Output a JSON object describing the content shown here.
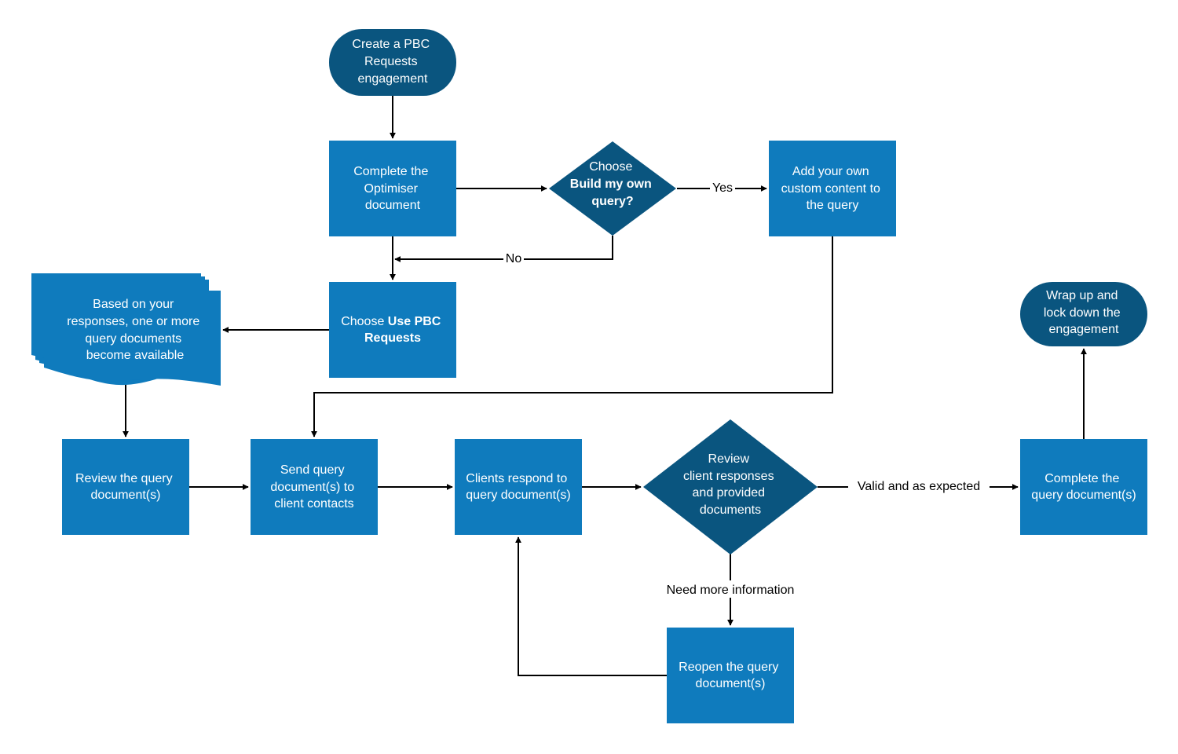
{
  "colors": {
    "process": "#0F7BBD",
    "terminator": "#0A557F",
    "decision": "#0A557F",
    "document": "#0F7BBD",
    "edge": "#000000",
    "text": "#ffffff"
  },
  "nodes": {
    "start": {
      "type": "terminator",
      "lines": [
        "Create a PBC",
        "Requests",
        "engagement"
      ]
    },
    "optimiser": {
      "type": "process",
      "lines": [
        "Complete the",
        "Optimiser",
        "document"
      ]
    },
    "decision_build": {
      "type": "decision",
      "line1": "Choose",
      "line2": "Build my own",
      "line3": "query?"
    },
    "custom": {
      "type": "process",
      "lines": [
        "Add your own",
        "custom content to",
        "the query"
      ]
    },
    "use_pbc": {
      "type": "process",
      "prefix": "Choose ",
      "bold1": "Use PBC",
      "bold2": "Requests"
    },
    "query_docs": {
      "type": "document",
      "lines": [
        "Based on your",
        "responses, one or more",
        "query documents",
        "become available"
      ]
    },
    "review": {
      "type": "process",
      "lines": [
        "Review the query",
        "document(s)"
      ]
    },
    "send": {
      "type": "process",
      "lines": [
        "Send query",
        "document(s) to",
        "client contacts"
      ]
    },
    "clients_respond": {
      "type": "process",
      "lines": [
        "Clients respond to",
        "query document(s)"
      ]
    },
    "decision_review": {
      "type": "decision",
      "lines": [
        "Review",
        "client responses",
        "and provided",
        "documents"
      ]
    },
    "complete": {
      "type": "process",
      "lines": [
        "Complete the",
        "query document(s)"
      ]
    },
    "wrap_up": {
      "type": "terminator",
      "lines": [
        "Wrap up and",
        "lock down the",
        "engagement"
      ]
    },
    "reopen": {
      "type": "process",
      "lines": [
        "Reopen the query",
        "document(s)"
      ]
    }
  },
  "edge_labels": {
    "yes": "Yes",
    "no": "No",
    "valid": "Valid and as expected",
    "need_more": "Need more information"
  }
}
